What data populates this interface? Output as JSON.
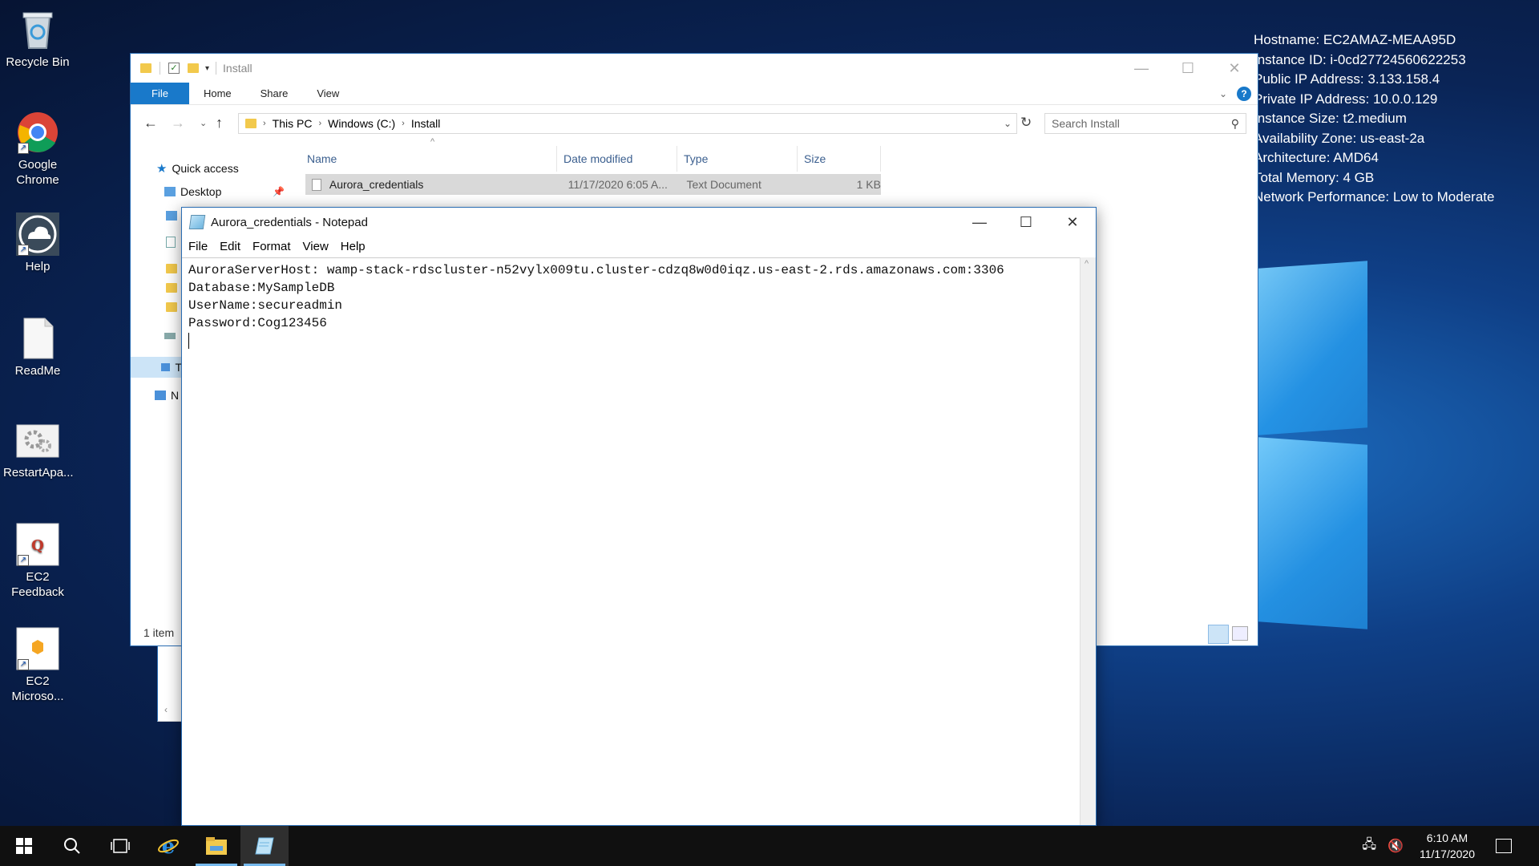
{
  "desktop": {
    "icons": [
      {
        "label": "Recycle Bin",
        "icon": "recycle-bin-icon"
      },
      {
        "label": "Google Chrome",
        "icon": "chrome-icon"
      },
      {
        "label": "Help",
        "icon": "help-cloud-icon"
      },
      {
        "label": "ReadMe",
        "icon": "text-document-icon"
      },
      {
        "label": "RestartApa...",
        "icon": "gear-script-icon"
      },
      {
        "label": "EC2 Feedback",
        "icon": "feedback-icon"
      },
      {
        "label": "EC2 Microso...",
        "icon": "ec2-package-icon"
      }
    ],
    "bginfo": [
      "Hostname: EC2AMAZ-MEAA95D",
      "Instance ID: i-0cd27724560622253",
      "Public IP Address: 3.133.158.4",
      "Private IP Address: 10.0.0.129",
      "Instance Size: t2.medium",
      "Availability Zone: us-east-2a",
      "Architecture: AMD64",
      "Total Memory: 4 GB",
      "Network Performance: Low to Moderate"
    ]
  },
  "explorer": {
    "title": "Install",
    "tabs": [
      "File",
      "Home",
      "Share",
      "View"
    ],
    "breadcrumb": [
      "This PC",
      "Windows (C:)",
      "Install"
    ],
    "search_placeholder": "Search Install",
    "nav": {
      "quick_access": "Quick access",
      "desktop": "Desktop",
      "this_pc_trunc": "T",
      "network_trunc": "N"
    },
    "columns": [
      "Name",
      "Date modified",
      "Type",
      "Size"
    ],
    "files": [
      {
        "name": "Aurora_credentials",
        "date": "11/17/2020 6:05 A...",
        "type": "Text Document",
        "size": "1 KB"
      }
    ],
    "status": "1 item"
  },
  "notepad": {
    "title": "Aurora_credentials - Notepad",
    "menu": [
      "File",
      "Edit",
      "Format",
      "View",
      "Help"
    ],
    "lines": [
      "AuroraServerHost: wamp-stack-rdscluster-n52vylx009tu.cluster-cdzq8w0d0iqz.us-east-2.rds.amazonaws.com:3306",
      "Database:MySampleDB",
      "UserName:secureadmin",
      "Password:Cog123456"
    ]
  },
  "taskbar": {
    "time": "6:10 AM",
    "date": "11/17/2020"
  }
}
